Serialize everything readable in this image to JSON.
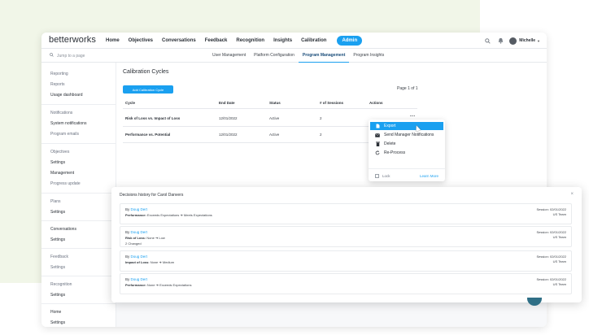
{
  "app": {
    "logo": "betterworks",
    "nav": [
      "Home",
      "Objectives",
      "Conversations",
      "Feedback",
      "Recognition",
      "Insights",
      "Calibration"
    ],
    "nav_active": "Admin",
    "user_name": "Michelle",
    "search_placeholder": "Jump to a page"
  },
  "subnav": {
    "tabs": [
      "User Management",
      "Platform Configuration",
      "Program Management",
      "Program Insights"
    ],
    "active_index": 2
  },
  "sidebar": {
    "sections": [
      {
        "items": [
          "Reporting",
          "Reports",
          "Usage dashboard"
        ]
      },
      {
        "items": [
          "Notifications",
          "System notifications",
          "Program emails"
        ]
      },
      {
        "items": [
          "Objectives",
          "Settings",
          "Management",
          "Progress update"
        ]
      },
      {
        "items": [
          "Plans",
          "Settings"
        ]
      },
      {
        "items": [
          "Conversations",
          "Settings"
        ]
      },
      {
        "items": [
          "Feedback",
          "Settings"
        ]
      },
      {
        "items": [
          "Recognition",
          "Settings"
        ]
      },
      {
        "items": [
          "Home",
          "Settings"
        ]
      }
    ]
  },
  "page": {
    "title": "Calibration Cycles",
    "add_button": "Add Calibration Cycle",
    "pagination": "Page 1 of 1",
    "columns": [
      "Cycle",
      "End Date",
      "Status",
      "# of Sessions",
      "Actions"
    ],
    "rows": [
      {
        "cycle": "Risk of Loss vs. Impact of Loss",
        "end_date": "12/01/2022",
        "status": "Active",
        "sessions": "2",
        "actions": "..."
      },
      {
        "cycle": "Performance vs. Potential",
        "end_date": "12/01/2022",
        "status": "Active",
        "sessions": "2",
        "actions": "..."
      }
    ]
  },
  "actions_menu": {
    "items": [
      {
        "label": "Export",
        "icon": "file-icon"
      },
      {
        "label": "Send Manager Notifications",
        "icon": "mail-icon"
      },
      {
        "label": "Delete",
        "icon": "trash-icon"
      },
      {
        "label": "Re-Process",
        "icon": "refresh-icon"
      }
    ],
    "highlighted_index": 0,
    "lock_label": "Lock",
    "learn_more": "Learn More"
  },
  "decisions": {
    "title": "Decisions history for Carol Danvers",
    "entries": [
      {
        "by_prefix": "By",
        "author": "Doug Dert",
        "field": "Performance:",
        "from": "Exceeds Expectations",
        "to": "Meets Expectations",
        "extra": "",
        "session": "Session: 02/01/2022",
        "team": "US Team"
      },
      {
        "by_prefix": "By",
        "author": "Doug Dert",
        "field": "Risk of Loss:",
        "from": "None",
        "to": "Low",
        "extra": "2 Changed",
        "session": "Session: 02/01/2022",
        "team": "US Team"
      },
      {
        "by_prefix": "By",
        "author": "Doug Dert",
        "field": "Impact of Loss:",
        "from": "None",
        "to": "Medium",
        "extra": "",
        "session": "Session: 02/01/2022",
        "team": "US Team"
      },
      {
        "by_prefix": "By",
        "author": "Doug Dert",
        "field": "Performance:",
        "from": "None",
        "to": "Exceeds Expectations",
        "extra": "",
        "session": "Session: 02/01/2022",
        "team": "US Team"
      }
    ]
  },
  "colors": {
    "accent": "#1aa0f0",
    "background_blob": "#f1f6e8",
    "text": "#2a2f36"
  }
}
